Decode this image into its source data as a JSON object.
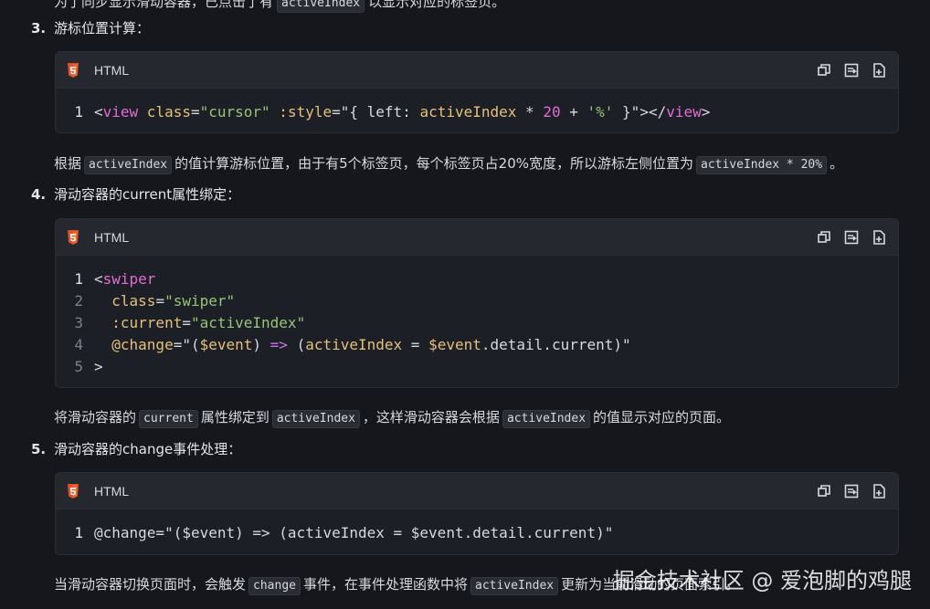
{
  "top_clip": {
    "text_before": "为了同步显示滑动容器，已点击了有",
    "code": "activeIndex",
    "text_after": "以显示对应的标签页。"
  },
  "step3": {
    "num": "3.",
    "title": "游标位置计算："
  },
  "block1": {
    "lang": "HTML",
    "line_numbers": [
      "1"
    ],
    "l1": {
      "lt": "<",
      "tag": "view",
      "a1": " class",
      "eq1": "=",
      "s1": "\"cursor\"",
      "a2": " :style",
      "eq2": "=",
      "q1": "\"{ ",
      "k": "left",
      "colon": ": ",
      "v": "activeIndex",
      "op1": " * ",
      "n": "20",
      "op2": " + ",
      "pct": "'%'",
      "close": " }\"",
      "gt": "></",
      "tag2": "view",
      "end": ">"
    }
  },
  "para1": {
    "t1": "根据",
    "c1": "activeIndex",
    "t2": "的值计算游标位置，由于有5个标签页，每个标签页占20%宽度，所以游标左侧位置为",
    "c2": "activeIndex * 20%",
    "t3": "。"
  },
  "step4": {
    "num": "4.",
    "title": "滑动容器的current属性绑定："
  },
  "block2": {
    "lang": "HTML",
    "ln": [
      "1",
      "2",
      "3",
      "4",
      "5"
    ],
    "l1_lt": "<",
    "l1_tag": "swiper",
    "l2_attr": "  class",
    "l2_eq": "=",
    "l2_str": "\"swiper\"",
    "l3_attr": "  :current",
    "l3_eq": "=",
    "l3_str": "\"activeIndex\"",
    "l4_attr": "  @change",
    "l4_eq": "=",
    "l4_q": "\"(",
    "l4_ev": "$event",
    "l4_p": ") ",
    "l4_arrow": "=>",
    "l4_p2": " (",
    "l4_v": "activeIndex",
    "l4_eq2": " = ",
    "l4_ev2": "$event",
    "l4_rest": ".detail.current",
    "l4_end": ")\"",
    "l5": ">"
  },
  "para2": {
    "t1": "将滑动容器的",
    "c1": "current",
    "t2": "属性绑定到",
    "c2": "activeIndex",
    "t3": "，这样滑动容器会根据",
    "c3": "activeIndex",
    "t4": "的值显示对应的页面。"
  },
  "step5": {
    "num": "5.",
    "title": "滑动容器的change事件处理："
  },
  "block3": {
    "lang": "HTML",
    "ln": "1",
    "code": "@change=\"($event) => (activeIndex = $event.detail.current)\""
  },
  "para3": {
    "t1": "当滑动容器切换页面时，会触发",
    "c1": "change",
    "t2": "事件，在事件处理函数中将",
    "c2": "activeIndex",
    "t3": "更新为当前滑动的页面索引。"
  },
  "watermark": "掘金技术社区 @ 爱泡脚的鸡腿",
  "colors": {
    "background": "#16171c",
    "code_bg": "#1d1f26",
    "header_bg": "#262830",
    "tag": "#e06cd4",
    "attr": "#e5c07b",
    "string": "#98c379"
  },
  "icons": {
    "lang": "html5-icon",
    "copy": "copy-icon",
    "wrap": "wrap-icon",
    "insert": "insert-icon"
  }
}
